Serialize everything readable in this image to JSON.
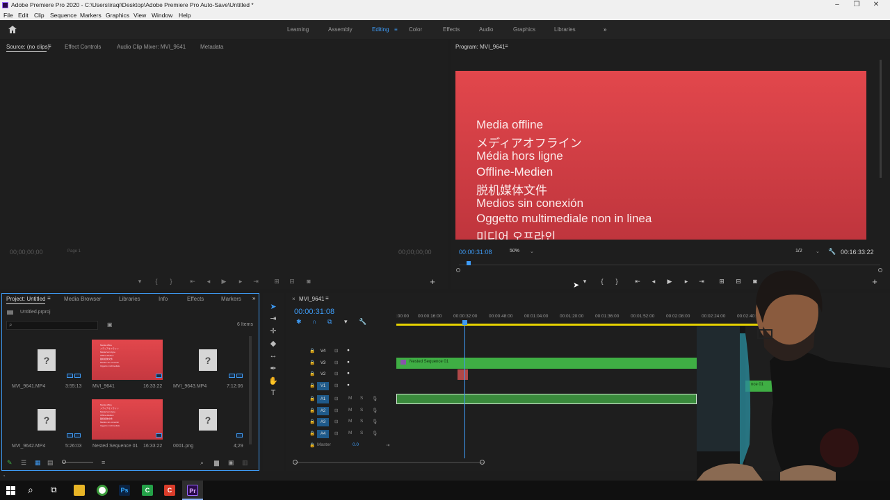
{
  "window": {
    "title": "Adobe Premiere Pro 2020 - C:\\Users\\iraqi\\Desktop\\Adobe Premiere Pro Auto-Save\\Untitled *",
    "controls": [
      "–",
      "❐",
      "✕"
    ]
  },
  "menu": [
    "File",
    "Edit",
    "Clip",
    "Sequence",
    "Markers",
    "Graphics",
    "View",
    "Window",
    "Help"
  ],
  "workspaces": {
    "items": [
      "Learning",
      "Assembly",
      "Editing",
      "Color",
      "Effects",
      "Audio",
      "Graphics",
      "Libraries"
    ],
    "active": "Editing",
    "more": "»"
  },
  "source_panel": {
    "tabs": [
      "Source: (no clips)",
      "Effect Controls",
      "Audio Clip Mixer: MVI_9641",
      "Metadata"
    ],
    "timecode_left": "00;00;00;00",
    "page": "Page 1",
    "timecode_right": "00;00;00;00"
  },
  "program_panel": {
    "title": "Program: MVI_9641",
    "offline_lines": [
      "Media offline",
      "メディアオフライン",
      "Média hors ligne",
      "Offline-Medien",
      "脱机媒体文件",
      "Medios sin conexión",
      "Oggetto multimediale non in linea",
      "미디어 오프라인"
    ],
    "timecode": "00:00:31:08",
    "zoom": "50%",
    "resolution": "1/2",
    "duration": "00:16:33:22"
  },
  "project_panel": {
    "tabs": [
      "Project: Untitled",
      "Media Browser",
      "Libraries",
      "Info",
      "Effects",
      "Markers"
    ],
    "file": "Untitled.prproj",
    "item_count": "6 Items",
    "items": [
      {
        "name": "MVI_9641.MP4",
        "duration": "3:55:13",
        "kind": "missing"
      },
      {
        "name": "MVI_9641",
        "duration": "16:33:22",
        "kind": "offline"
      },
      {
        "name": "MVI_9643.MP4",
        "duration": "7:12:06",
        "kind": "missing"
      },
      {
        "name": "MVI_9642.MP4",
        "duration": "5:26:03",
        "kind": "missing"
      },
      {
        "name": "Nested Sequence 01",
        "duration": "16:33:22",
        "kind": "offline"
      },
      {
        "name": "0001.png",
        "duration": "4;29",
        "kind": "missing"
      }
    ]
  },
  "timeline": {
    "sequence_tab": "MVI_9641",
    "timecode": "00:00:31:08",
    "ruler": [
      ":00:00",
      "00:00:16:00",
      "00:00:32:00",
      "00:00:48:00",
      "00:01:04:00",
      "00:01:20:00",
      "00:01:36:00",
      "00:01:52:00",
      "00:02:08:00",
      "00:02:24:00",
      "00:02:40:00"
    ],
    "video_tracks": [
      "V4",
      "V3",
      "V2",
      "V1"
    ],
    "audio_tracks": [
      "A1",
      "A2",
      "A3",
      "A4"
    ],
    "master_label": "Master",
    "master_value": "0.0",
    "clip_v3": "Nested Sequence 01",
    "clip_v1": "nce 01"
  },
  "colors": {
    "accent": "#3e9bf5",
    "clip": "#3fae44",
    "offline": "#e2474c"
  }
}
